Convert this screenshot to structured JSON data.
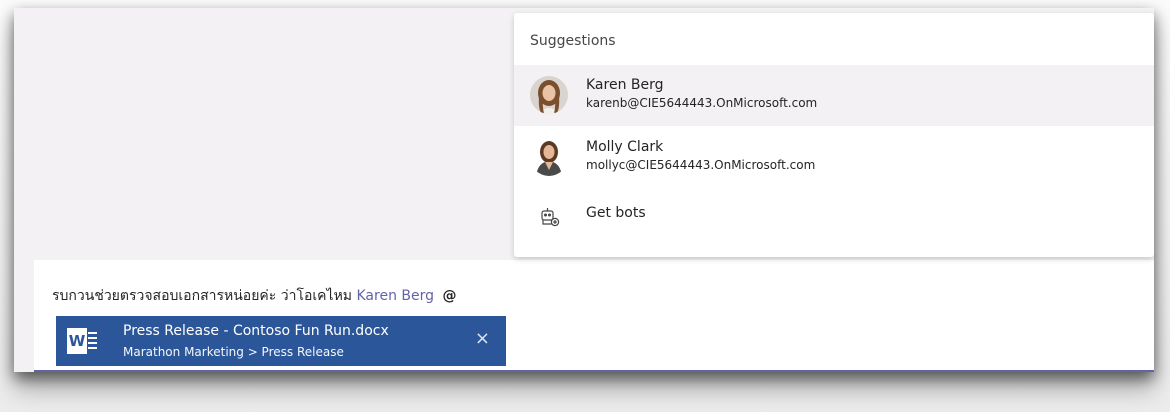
{
  "suggestions": {
    "header": "Suggestions",
    "people": [
      {
        "name": "Karen Berg",
        "email": "karenb@CIE5644443.OnMicrosoft.com",
        "highlighted": true
      },
      {
        "name": "Molly Clark",
        "email": "mollyc@CIE5644443.OnMicrosoft.com",
        "highlighted": false
      }
    ],
    "bots": {
      "label": "Get bots",
      "icon": "bot-add-icon"
    }
  },
  "compose": {
    "message_text": "รบกวนช่วยตรวจสอบเอกสารหน่อยค่ะ ว่าโอเคไหม",
    "mention": "Karen Berg",
    "at_symbol": "@",
    "attachment": {
      "title": "Press Release - Contoso Fun Run.docx",
      "path": "Marathon Marketing > Press Release",
      "close_glyph": "×",
      "icon": "word-icon",
      "color": "#2b579a"
    }
  },
  "colors": {
    "accent": "#6264a7",
    "word_blue": "#2b579a",
    "highlight_bg": "#f3f1f3"
  }
}
